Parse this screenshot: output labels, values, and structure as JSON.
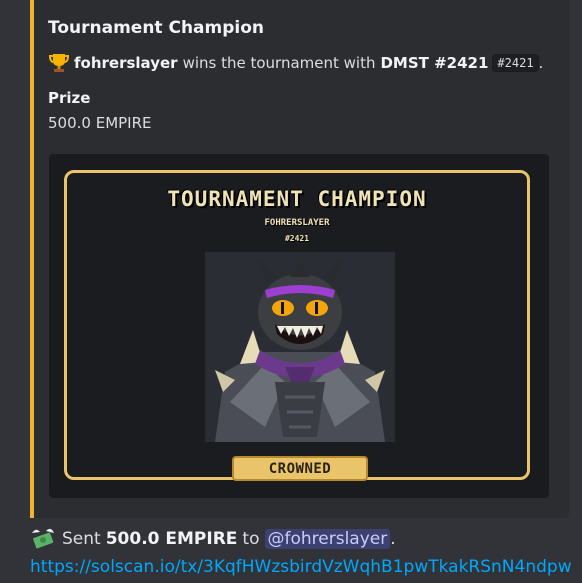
{
  "embed": {
    "title": "Tournament Champion",
    "description": {
      "user": "fohrerslayer",
      "text_mid": "wins the tournament with",
      "nft_name": "DMST #2421",
      "code_tag": "#2421",
      "end": "."
    },
    "field": {
      "name": "Prize",
      "value": "500.0 EMPIRE"
    },
    "accent_color": "#f0b232",
    "image": {
      "title": "TOURNAMENT CHAMPION",
      "name": "FOHRERSLAYER",
      "id": "#2421",
      "badge": "CROWNED",
      "icon": "dragon-warrior-nft"
    }
  },
  "message": {
    "icon": "money-with-wings-icon",
    "prefix": "Sent",
    "amount": "500.0 EMPIRE",
    "to": "to",
    "mention": "@fohrerslayer",
    "end": ".",
    "link": "https://solscan.io/tx/3KqfHWzsbirdVzWqhB1pwTkakRSnN4ndpw"
  },
  "colors": {
    "background": "#313338",
    "embed_bg": "#2b2d31",
    "link": "#00a8fc",
    "gold": "#e9c46a"
  }
}
